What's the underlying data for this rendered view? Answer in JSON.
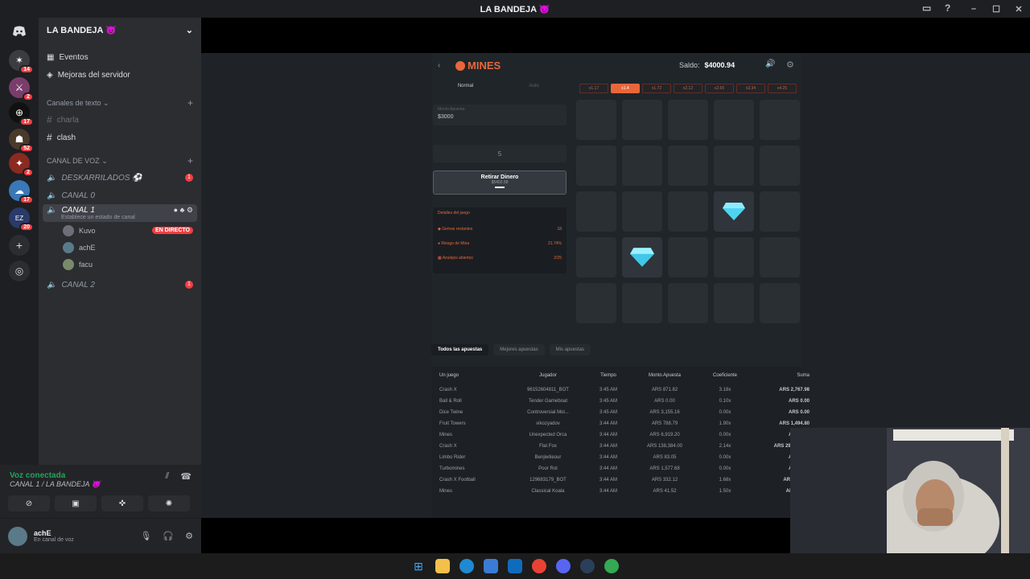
{
  "window": {
    "title": "LA BANDEJA 😈"
  },
  "servers": [
    {
      "badge": "14",
      "glyph": "✶"
    },
    {
      "badge": "2",
      "glyph": "⚔"
    },
    {
      "badge": "17",
      "glyph": "⊕"
    },
    {
      "badge": "52",
      "glyph": "☗"
    },
    {
      "badge": "2",
      "glyph": "✦"
    },
    {
      "badge": "17",
      "glyph": "☁"
    },
    {
      "badge": "20",
      "glyph": "EZ"
    }
  ],
  "sidebar": {
    "guild_name": "LA BANDEJA 😈",
    "events": "Eventos",
    "boosts": "Mejoras del servidor",
    "text_category": "Canales de texto",
    "text_channels": [
      "charla",
      "clash"
    ],
    "voice_category": "CANAL DE VOZ",
    "voice_channels": {
      "deskarrilados": "DESKARRILADOS ⚽",
      "deskarrilados_badge": "1",
      "canal0": "CANAL 0",
      "canal1": "CANAL 1",
      "canal1_status": "Establece un estado de canal",
      "canal2": "CANAL 2",
      "canal2_badge": "1"
    },
    "members": [
      {
        "name": "Kuvo",
        "live": "EN DIRECTO"
      },
      {
        "name": "achE"
      },
      {
        "name": "facu"
      }
    ]
  },
  "voice_panel": {
    "status": "Voz conectada",
    "channel": "CANAL 1 / LA BANDEJA 😈"
  },
  "user_panel": {
    "username": "achE",
    "status": "En canal de voz"
  },
  "game": {
    "logo": "MINES",
    "balance_label": "Saldo:",
    "balance": "$4000.94",
    "mode_normal": "Normal",
    "mode_auto": "Auto",
    "bet_label": "Monto Apuesta",
    "bet_value": "$3000",
    "mines_count": "5",
    "cashout_label": "Retirar Dinero",
    "cashout_value": "$5402.58",
    "details_title": "Detalles del juego",
    "details": [
      {
        "label": "Gemas restantes",
        "value": "18"
      },
      {
        "label": "Riesgo de Mina",
        "value": "21.74%"
      },
      {
        "label": "Azulejos abiertos",
        "value": "2/25"
      }
    ],
    "multipliers": [
      "x1.17",
      "x1.4",
      "x1.72",
      "x2.12",
      "x2.65",
      "x3.34",
      "x4.25"
    ],
    "multiplier_active_index": 1
  },
  "bets": {
    "tabs": [
      "Todos las apuestas",
      "Mejores apuestas",
      "Mis apuestas"
    ],
    "headers": [
      "Un juego",
      "Jugador",
      "Tiempo",
      "Monto Apuesta",
      "Coeficiente",
      "Suma"
    ],
    "rows": [
      [
        "Crash X",
        "96152604811_BOT",
        "3:45 AM",
        "ARS 871.82",
        "3.18x",
        "ARS 2,767.98"
      ],
      [
        "Ball & Roll",
        "Tender Gameboat",
        "3:45 AM",
        "ARS 0.00",
        "0.10x",
        "ARS 0.00"
      ],
      [
        "Dice Twine",
        "Controversial Moi...",
        "3:45 AM",
        "ARS 3,155.16",
        "0.00x",
        "ARS 0.00"
      ],
      [
        "Fruit Towers",
        "vikozyadov",
        "3:44 AM",
        "ARS 788.79",
        "1.90x",
        "ARS 1,494.80"
      ],
      [
        "Mines",
        "Unexpected Orca",
        "3:44 AM",
        "ARS 6,919.20",
        "0.00x",
        "ARS 0.00"
      ],
      [
        "Crash X",
        "Flat Fox",
        "3:44 AM",
        "ARS 138,384.00",
        "2.14x",
        "ARS 296,141.76"
      ],
      [
        "Limbo Rider",
        "Benjiwtieour",
        "3:44 AM",
        "ARS 83.05",
        "0.00x",
        "ARS 0.00"
      ],
      [
        "Turbomines",
        "Poor Rot",
        "3:44 AM",
        "ARS 1,577.68",
        "0.00x",
        "ARS 0.00"
      ],
      [
        "Crash X Football",
        "129683179_BOT",
        "3:44 AM",
        "ARS 332.12",
        "1.68x",
        "ARS 553.58"
      ],
      [
        "Mines",
        "Classical Koala",
        "3:44 AM",
        "ARS 41.52",
        "1.50x",
        "ARS 69.20"
      ]
    ]
  },
  "colors": {
    "accent": "#e8673a",
    "discord_red": "#f23f42",
    "voice_green": "#23a55a",
    "gem": "#4fd4f0"
  }
}
